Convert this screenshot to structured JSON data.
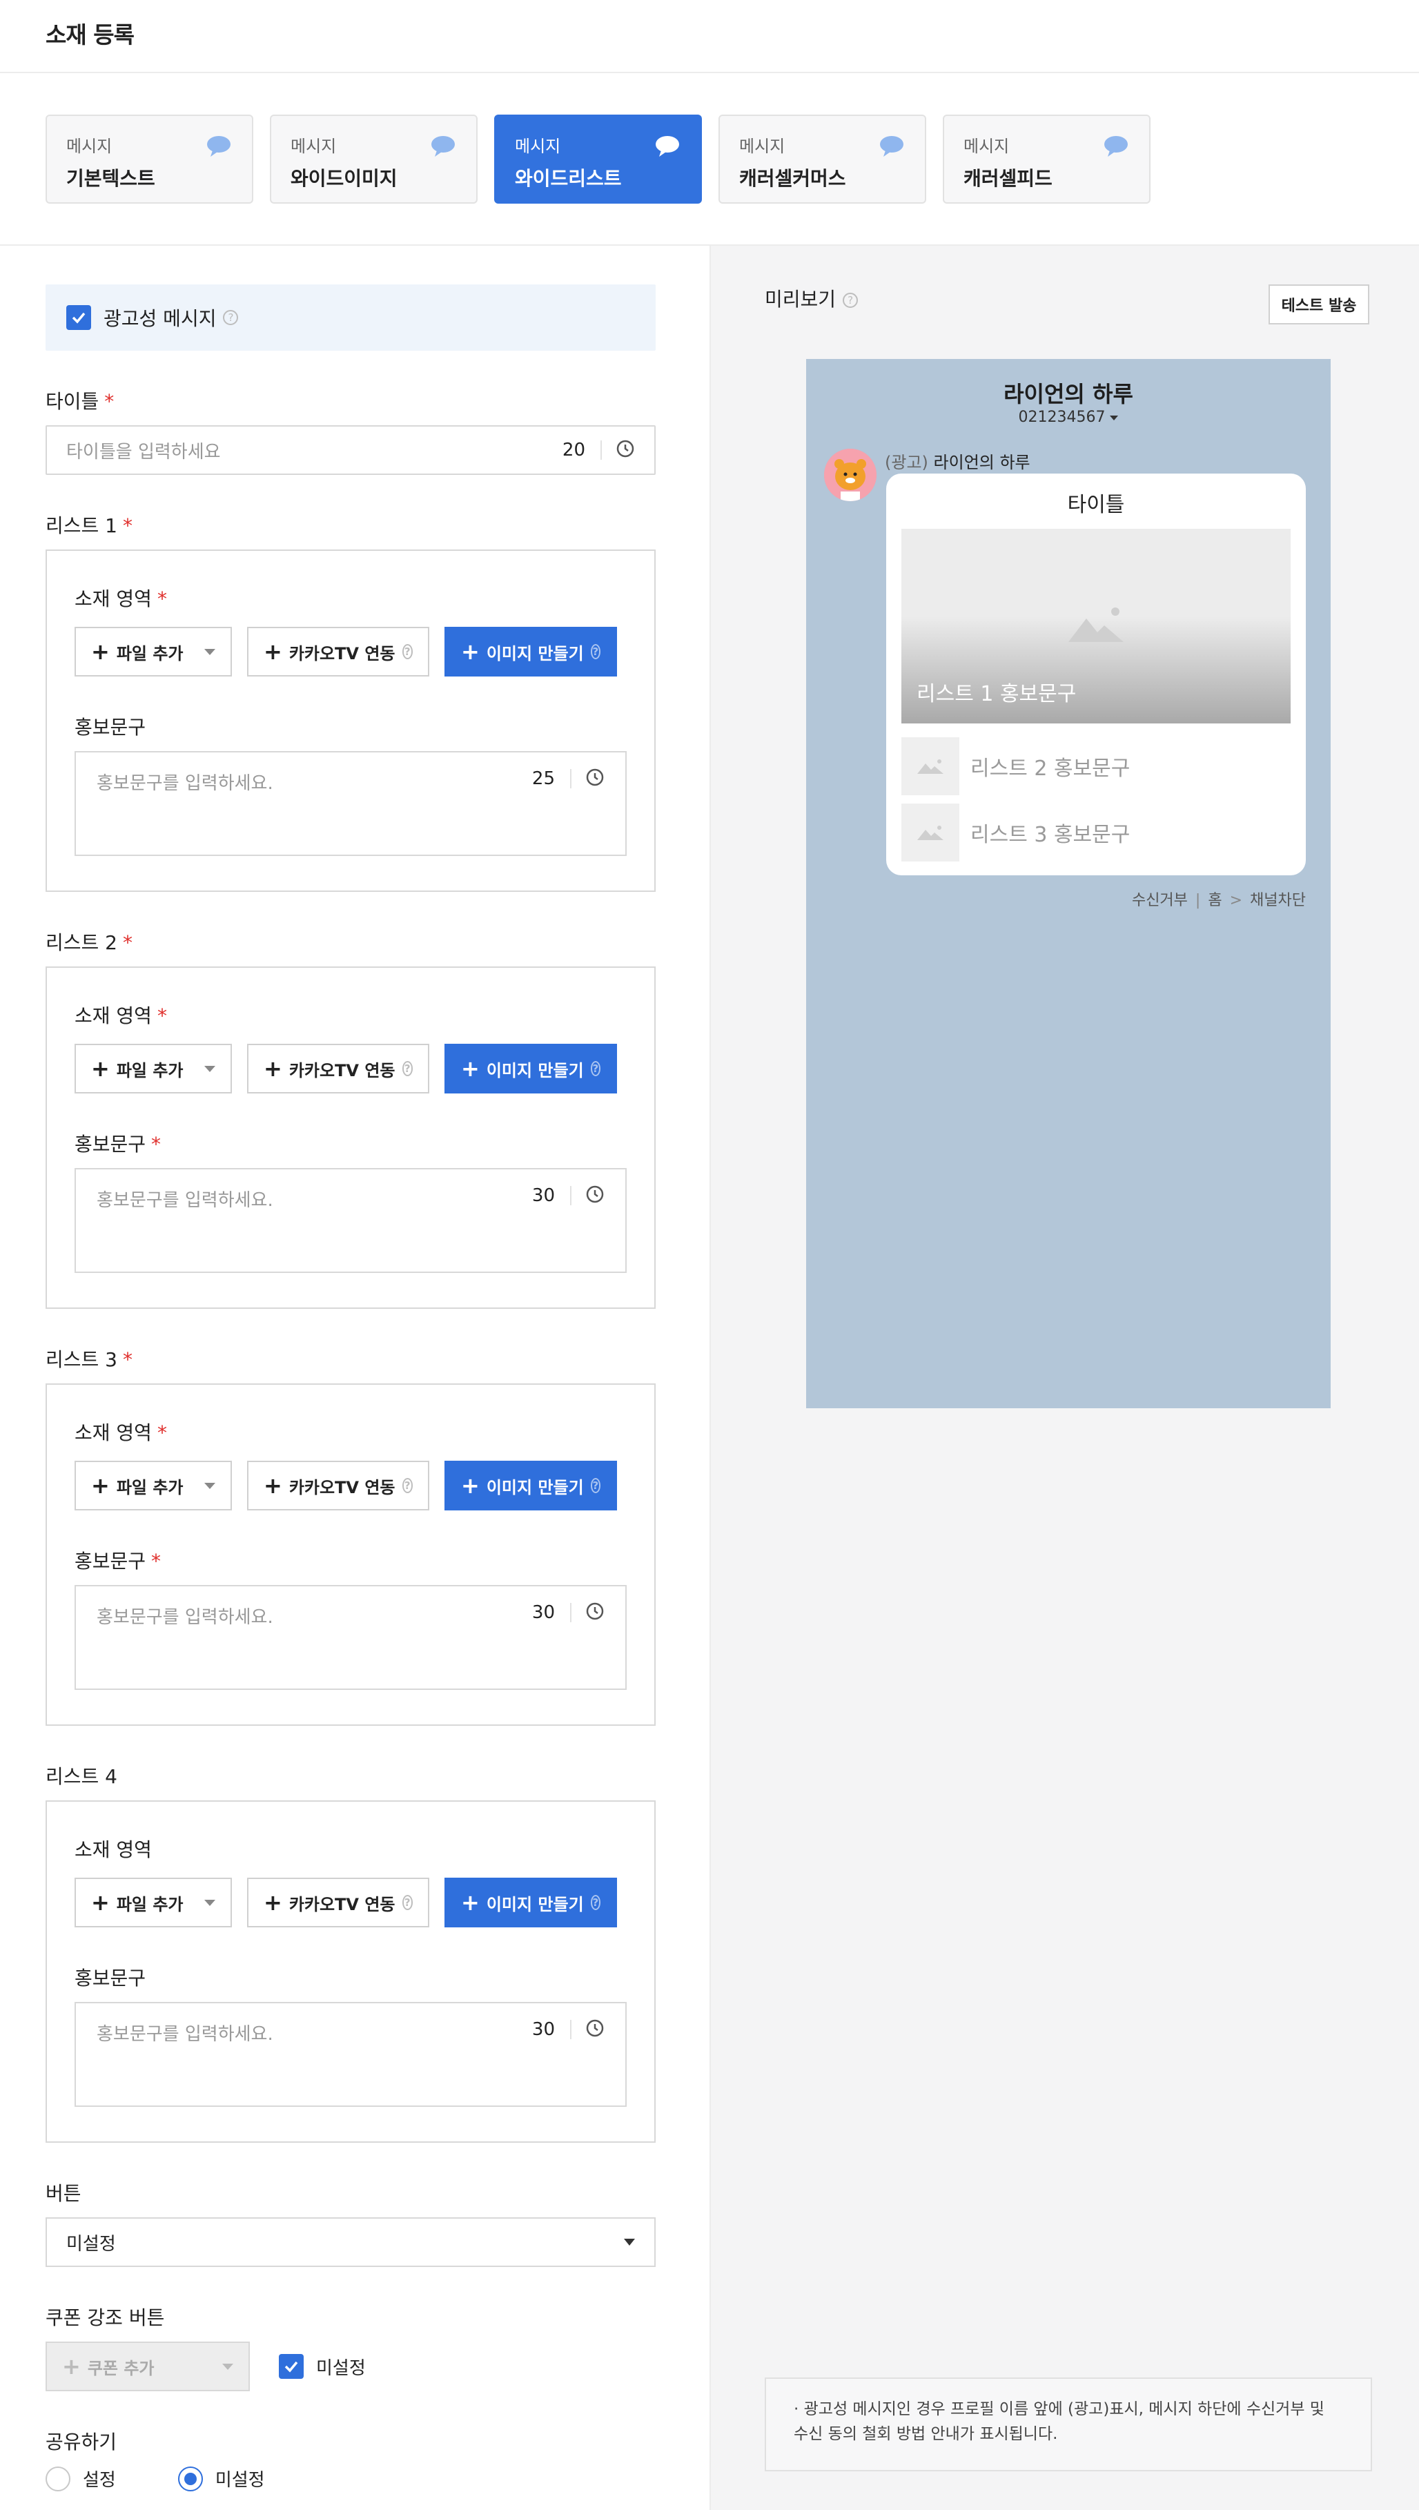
{
  "header": {
    "title": "소재 등록"
  },
  "types": [
    {
      "sub": "메시지",
      "label": "기본텍스트",
      "active": false
    },
    {
      "sub": "메시지",
      "label": "와이드이미지",
      "active": false
    },
    {
      "sub": "메시지",
      "label": "와이드리스트",
      "active": true
    },
    {
      "sub": "메시지",
      "label": "캐러셀커머스",
      "active": false
    },
    {
      "sub": "메시지",
      "label": "캐러셀피드",
      "active": false
    }
  ],
  "ad_message": {
    "label": "광고성 메시지",
    "checked": true
  },
  "title_field": {
    "label": "타이틀",
    "placeholder": "타이틀을 입력하세요",
    "count": "20"
  },
  "lists": [
    {
      "label": "리스트 1",
      "required": "*",
      "area_label": "소재 영역",
      "area_required": "*",
      "file_btn": "파일 추가",
      "kakao_btn": "카카오TV 연동",
      "make_btn": "이미지 만들기",
      "promo_label": "홍보문구",
      "promo_required": "",
      "placeholder": "홍보문구를 입력하세요.",
      "count": "25"
    },
    {
      "label": "리스트 2",
      "required": "*",
      "area_label": "소재 영역",
      "area_required": "*",
      "file_btn": "파일 추가",
      "kakao_btn": "카카오TV 연동",
      "make_btn": "이미지 만들기",
      "promo_label": "홍보문구",
      "promo_required": "*",
      "placeholder": "홍보문구를 입력하세요.",
      "count": "30"
    },
    {
      "label": "리스트 3",
      "required": "*",
      "area_label": "소재 영역",
      "area_required": "*",
      "file_btn": "파일 추가",
      "kakao_btn": "카카오TV 연동",
      "make_btn": "이미지 만들기",
      "promo_label": "홍보문구",
      "promo_required": "*",
      "placeholder": "홍보문구를 입력하세요.",
      "count": "30"
    },
    {
      "label": "리스트 4",
      "required": "",
      "area_label": "소재 영역",
      "area_required": "",
      "file_btn": "파일 추가",
      "kakao_btn": "카카오TV 연동",
      "make_btn": "이미지 만들기",
      "promo_label": "홍보문구",
      "promo_required": "",
      "placeholder": "홍보문구를 입력하세요.",
      "count": "30"
    }
  ],
  "button_field": {
    "label": "버튼",
    "value": "미설정"
  },
  "coupon": {
    "label": "쿠폰 강조 버튼",
    "btn": "쿠폰 추가",
    "checkbox_label": "미설정",
    "checked": true
  },
  "share": {
    "label": "공유하기",
    "options": [
      "설정",
      "미설정"
    ],
    "selected": "미설정"
  },
  "preview": {
    "title": "미리보기",
    "test_btn": "테스트 발송",
    "channel_name": "라이언의 하루",
    "channel_number": "021234567",
    "sender_ad": "(광고)",
    "sender_name": "라이언의 하루",
    "card_title": "타이틀",
    "list1": "리스트 1 홍보문구",
    "list2": "리스트 2 홍보문구",
    "list3": "리스트 3 홍보문구",
    "footer": {
      "reject": "수신거부",
      "sep": "|",
      "home": "홈",
      "arrow": ">",
      "block": "채널차단"
    }
  },
  "notice": "· 광고성 메시지인 경우 프로필 이름 앞에 (광고)표시, 메시지 하단에 수신거부 및 수신 동의 철회 방법 안내가 표시됩니다.",
  "colors": {
    "accent": "#2f6fdc",
    "required": "#e0302d",
    "preview_bg": "#b3c6d8"
  }
}
